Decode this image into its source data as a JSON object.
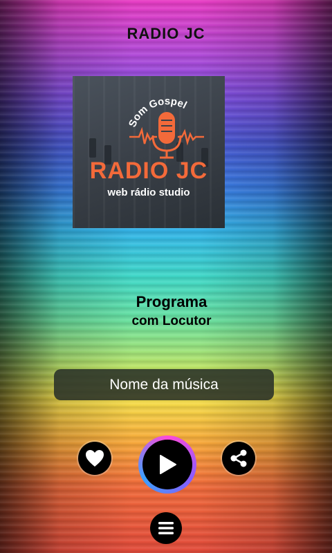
{
  "app": {
    "title": "RADIO JC"
  },
  "logo": {
    "arc_text": "Som Gospel",
    "main_text": "RADIO JC",
    "sub_text": "web rádio studio",
    "accent_color": "#f36a3a"
  },
  "program": {
    "name": "Programa",
    "host": "com Locutor"
  },
  "now_playing": {
    "song": "Nome da música"
  },
  "controls": {
    "favorite_icon": "heart-icon",
    "play_icon": "play-icon",
    "share_icon": "share-icon",
    "menu_icon": "menu-icon"
  }
}
